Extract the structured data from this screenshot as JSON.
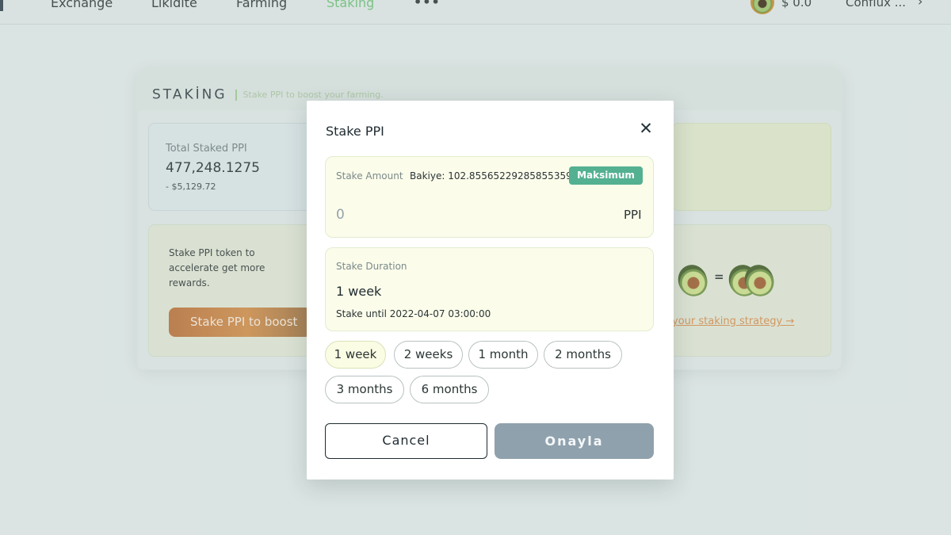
{
  "nav": {
    "items": [
      {
        "label": "Exchange"
      },
      {
        "label": "Likidite"
      },
      {
        "label": "Farming"
      },
      {
        "label": "Staking",
        "active": true
      }
    ],
    "more_label": "•••",
    "balance": "$ 0.0",
    "account": "Conflux ...",
    "chevron": "›",
    "coin_icon": "avocado-coin-icon"
  },
  "staking_page": {
    "title": "STAKİNG",
    "subtitle": "Stake PPI to boost your farming.",
    "total_staked": {
      "label": "Total Staked PPI",
      "value": "477,248.1275",
      "usd": "- $5,129.72"
    },
    "promo_text": "Stake PPI token to accelerate get more rewards.",
    "boost_button": "Stake PPI to boost",
    "avocado_equals": "=",
    "strategy_link": "your staking strategy →"
  },
  "modal": {
    "title": "Stake PPI",
    "close_icon": "close-icon",
    "amount": {
      "label": "Stake Amount",
      "balance_text": "Bakiye: 102.855652292858553598",
      "max_label": "Maksimum",
      "placeholder": "0",
      "unit": "PPI"
    },
    "duration": {
      "label": "Stake Duration",
      "value": "1 week",
      "until": "Stake until 2022-04-07 03:00:00",
      "options": [
        "1 week",
        "2 weeks",
        "1 month",
        "2 months",
        "3 months",
        "6 months"
      ],
      "selected": "1 week"
    },
    "cancel_label": "Cancel",
    "confirm_label": "Onayla"
  },
  "colors": {
    "accent_green": "#53b091",
    "nav_active": "#6bbf74",
    "confirm_disabled": "#8fa1ad",
    "boost_orange": "#cf8a44"
  }
}
